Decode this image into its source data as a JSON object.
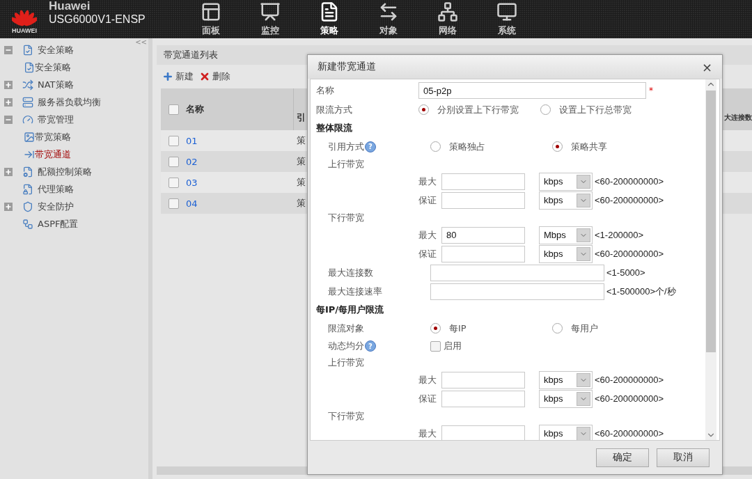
{
  "header": {
    "logo_text": "HUAWEI",
    "brand": "Huawei",
    "device": "USG6000V1-ENSP",
    "nav": [
      {
        "label": "面板",
        "selected": false
      },
      {
        "label": "监控",
        "selected": false
      },
      {
        "label": "策略",
        "selected": true
      },
      {
        "label": "对象",
        "selected": false
      },
      {
        "label": "网络",
        "selected": false
      },
      {
        "label": "系统",
        "selected": false
      }
    ]
  },
  "sidebar": {
    "collapse": "<<",
    "items": [
      {
        "label": "安全策略",
        "expanded": true,
        "selected": false,
        "children": [
          {
            "label": "安全策略",
            "selected": false
          }
        ]
      },
      {
        "label": "NAT策略",
        "expanded": false,
        "selected": false
      },
      {
        "label": "服务器负载均衡",
        "expanded": false,
        "selected": false
      },
      {
        "label": "带宽管理",
        "expanded": true,
        "selected": false,
        "children": [
          {
            "label": "带宽策略",
            "selected": false
          },
          {
            "label": "带宽通道",
            "selected": true
          }
        ]
      },
      {
        "label": "配额控制策略",
        "expanded": false,
        "selected": false
      },
      {
        "label": "代理策略",
        "selected": false
      },
      {
        "label": "安全防护",
        "expanded": false,
        "selected": false
      },
      {
        "label": "ASPF配置",
        "selected": false
      }
    ]
  },
  "panel": {
    "title": "带宽通道列表",
    "toolbar": [
      {
        "kind": "add",
        "label": "新建"
      },
      {
        "kind": "delete",
        "label": "删除"
      }
    ],
    "table": {
      "columns": [
        "名称",
        "引",
        "大连接数"
      ],
      "header_checked": false,
      "rows": [
        {
          "name": "01",
          "column_2": "策",
          "checked": false
        },
        {
          "name": "02",
          "column_2": "策",
          "checked": false
        },
        {
          "name": "03",
          "column_2": "策",
          "checked": false
        },
        {
          "name": "04",
          "column_2": "策",
          "checked": false
        }
      ]
    }
  },
  "dialog": {
    "title": "新建带宽通道",
    "close": "×",
    "rows": [
      {
        "kind": "text",
        "label": "名称",
        "value": "05-p2p",
        "required": "*"
      },
      {
        "kind": "radio",
        "label": "限流方式",
        "options": [
          {
            "label": "分别设置上下行带宽",
            "selected": true
          },
          {
            "label": "设置上下行总带宽",
            "selected": false
          }
        ]
      },
      {
        "kind": "section",
        "label": "整体限流"
      },
      {
        "kind": "radio",
        "label": "引用方式",
        "help": "?",
        "options": [
          {
            "label": "策略独占",
            "selected": false
          },
          {
            "label": "策略共享",
            "selected": true
          }
        ]
      },
      {
        "kind": "group",
        "label": "上行带宽"
      },
      {
        "kind": "bandwidth",
        "label": "最大",
        "unit": "kbps",
        "range": "<60-200000000>"
      },
      {
        "kind": "bandwidth",
        "label": "保证",
        "unit": "kbps",
        "range": "<60-200000000>"
      },
      {
        "kind": "group",
        "label": "下行带宽"
      },
      {
        "kind": "bandwidth",
        "label": "最大",
        "value": "80",
        "unit": "Mbps",
        "range": "<1-200000>"
      },
      {
        "kind": "bandwidth",
        "label": "保证",
        "unit": "kbps",
        "range": "<60-200000000>"
      },
      {
        "kind": "range",
        "label": "最大连接数",
        "range": "<1-5000>"
      },
      {
        "kind": "range",
        "label": "最大连接速率",
        "range": "<1-500000>个/秒"
      },
      {
        "kind": "section",
        "label": "每IP/每用户限流"
      },
      {
        "kind": "radio",
        "label": "限流对象",
        "options": [
          {
            "label": "每IP",
            "selected": true
          },
          {
            "label": "每用户",
            "selected": false
          }
        ]
      },
      {
        "kind": "checkbox",
        "label": "动态均分",
        "help": "?",
        "option": "启用",
        "checked": false
      },
      {
        "kind": "group",
        "label": "上行带宽"
      },
      {
        "kind": "bandwidth",
        "label": "最大",
        "unit": "kbps",
        "range": "<60-200000000>"
      },
      {
        "kind": "bandwidth",
        "label": "保证",
        "unit": "kbps",
        "range": "<60-200000000>"
      },
      {
        "kind": "group",
        "label": "下行带宽"
      },
      {
        "kind": "bandwidth",
        "label": "最大",
        "unit": "kbps",
        "range": "<60-200000000>"
      }
    ],
    "buttons": [
      "确定",
      "取消"
    ]
  }
}
